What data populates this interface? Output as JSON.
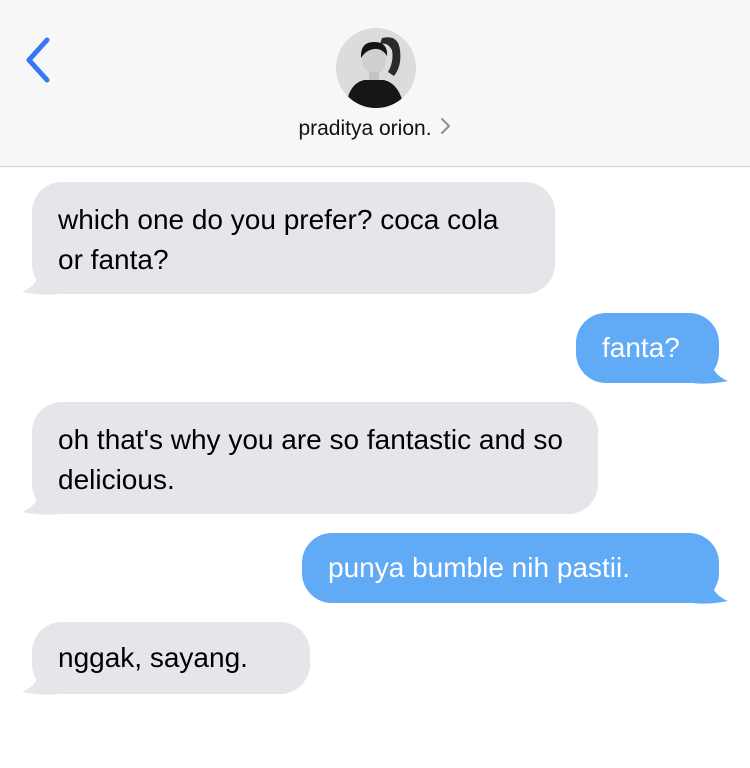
{
  "header": {
    "contact_name": "praditya orion.",
    "chevron": "chevron-right-icon",
    "back": "chevron-left-icon"
  },
  "colors": {
    "accent": "#3478f6",
    "incoming_bubble": "#e5e5ea",
    "outgoing_bubble": "#60aaf6",
    "header_bg": "#f7f7f7"
  },
  "messages": [
    {
      "direction": "incoming",
      "text": "which one do you prefer? coca cola or fanta?"
    },
    {
      "direction": "outgoing",
      "text": "fanta?"
    },
    {
      "direction": "incoming",
      "text": "oh that's why you are so fantastic and so delicious."
    },
    {
      "direction": "outgoing",
      "text": "punya bumble nih pastii."
    },
    {
      "direction": "incoming",
      "text": "nggak, sayang."
    }
  ]
}
